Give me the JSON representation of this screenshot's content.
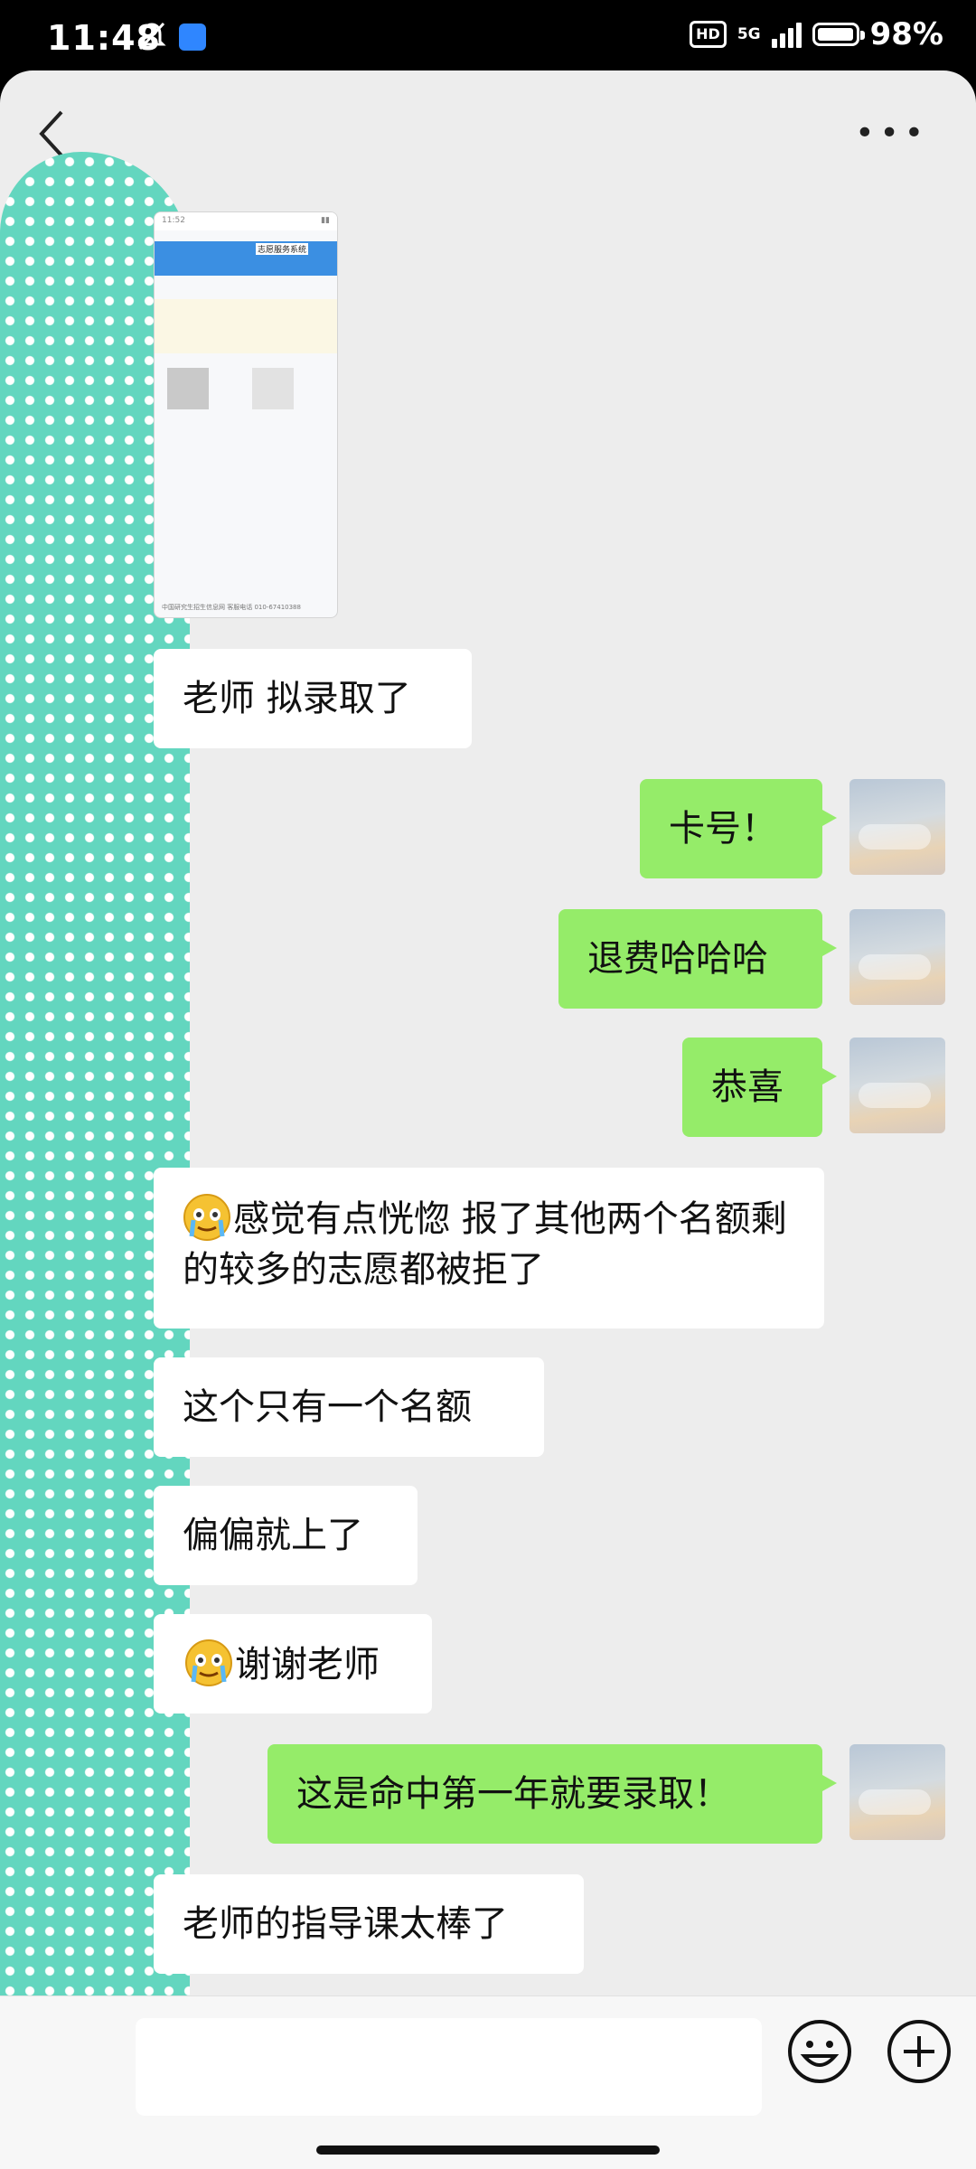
{
  "status_bar": {
    "time": "11:48",
    "hd": "HD",
    "network": "5G",
    "battery_level": 0.98,
    "battery_text": "98%"
  },
  "colors": {
    "incoming_bubble": "#ffffff",
    "outgoing_bubble": "#95ec69",
    "chat_background": "#ededed",
    "redaction_strip": "#63d6bf"
  },
  "screenshot_message": {
    "status_time": "11:52",
    "header_title": "志愿服务系统",
    "footer_text": "中国研究生招生信息网  客服电话 010-67410388"
  },
  "messages": [
    {
      "side": "in",
      "text": "老师 拟录取了"
    },
    {
      "side": "out",
      "text": "卡号！"
    },
    {
      "side": "out",
      "text": "退费哈哈哈"
    },
    {
      "side": "out",
      "text": "恭喜"
    },
    {
      "side": "in",
      "emoji": "crying-smile-emoji",
      "text": "感觉有点恍惚 报了其他两个名额剩的较多的志愿都被拒了"
    },
    {
      "side": "in",
      "text": "这个只有一个名额"
    },
    {
      "side": "in",
      "text": "偏偏就上了"
    },
    {
      "side": "in",
      "emoji": "crying-smile-emoji",
      "text": "谢谢老师"
    },
    {
      "side": "out",
      "text": "这是命中第一年就要录取！"
    },
    {
      "side": "in",
      "text": "老师的指导课太棒了"
    }
  ],
  "toolbar": {
    "more_label": "•••"
  }
}
